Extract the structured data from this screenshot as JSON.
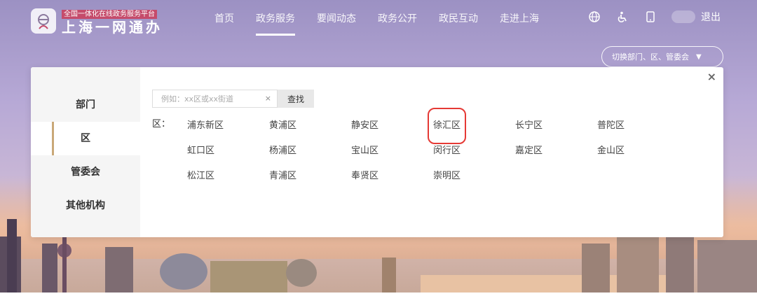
{
  "header": {
    "logo_small": "全国一体化在线政务服务平台",
    "logo_big": "上海一网通办",
    "nav": [
      {
        "label": "首页",
        "active": false
      },
      {
        "label": "政务服务",
        "active": true
      },
      {
        "label": "要闻动态",
        "active": false
      },
      {
        "label": "政务公开",
        "active": false
      },
      {
        "label": "政民互动",
        "active": false
      },
      {
        "label": "走进上海",
        "active": false
      }
    ],
    "tool_icons": [
      "globe-icon",
      "accessibility-icon",
      "mobile-icon"
    ],
    "logout_label": "退出",
    "switch_label": "切换部门、区、管委会"
  },
  "panel": {
    "side_items": [
      {
        "label": "部门",
        "active": false
      },
      {
        "label": "区",
        "active": true
      },
      {
        "label": "管委会",
        "active": false
      },
      {
        "label": "其他机构",
        "active": false
      }
    ],
    "search": {
      "placeholder": "例如：xx区或xx街道",
      "clear_label": "×",
      "button_label": "查找"
    },
    "close_label": "×",
    "district_label": "区：",
    "districts": [
      "浦东新区",
      "黄浦区",
      "静安区",
      "徐汇区",
      "长宁区",
      "普陀区",
      "虹口区",
      "杨浦区",
      "宝山区",
      "闵行区",
      "嘉定区",
      "金山区",
      "松江区",
      "青浦区",
      "奉贤区",
      "崇明区"
    ],
    "highlighted_district": "徐汇区"
  },
  "colors": {
    "accent_gold": "#c9a878",
    "highlight_red": "#e53935",
    "logo_badge": "#c54b6b"
  }
}
